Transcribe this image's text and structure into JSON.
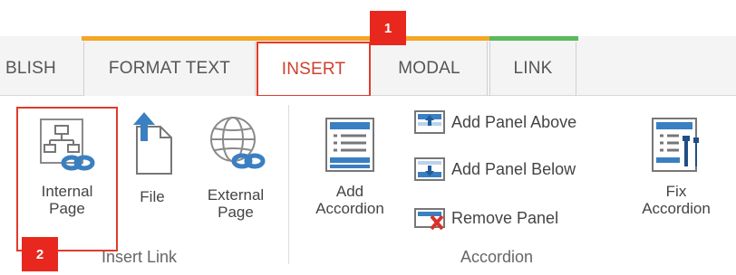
{
  "tabs": [
    {
      "label": "BLISH"
    },
    {
      "label": "FORMAT TEXT"
    },
    {
      "label": "INSERT"
    },
    {
      "label": "MODAL"
    },
    {
      "label": "LINK"
    }
  ],
  "callouts": {
    "first": "1",
    "second": "2"
  },
  "insert_link_group": {
    "label": "Insert Link",
    "buttons": {
      "internal_page": "Internal\nPage",
      "file": "File",
      "external_page": "External\nPage"
    }
  },
  "accordion_group": {
    "label": "Accordion",
    "add_accordion": "Add\nAccordion",
    "add_panel_above": "Add Panel Above",
    "add_panel_below": "Add Panel Below",
    "remove_panel": "Remove Panel",
    "fix_accordion": "Fix\nAccordion"
  },
  "colors": {
    "accent_orange": "#f5a623",
    "accent_green": "#5cb85c",
    "highlight_red": "#e03b2c",
    "icon_blue": "#3a7fc1"
  },
  "icons": {
    "internal_page": "sitemap-link-icon",
    "file": "file-upload-icon",
    "external_page": "globe-link-icon",
    "add_accordion": "accordion-icon",
    "add_panel_above": "panel-above-icon",
    "add_panel_below": "panel-below-icon",
    "remove_panel": "remove-panel-icon",
    "fix_accordion": "fix-accordion-icon"
  }
}
